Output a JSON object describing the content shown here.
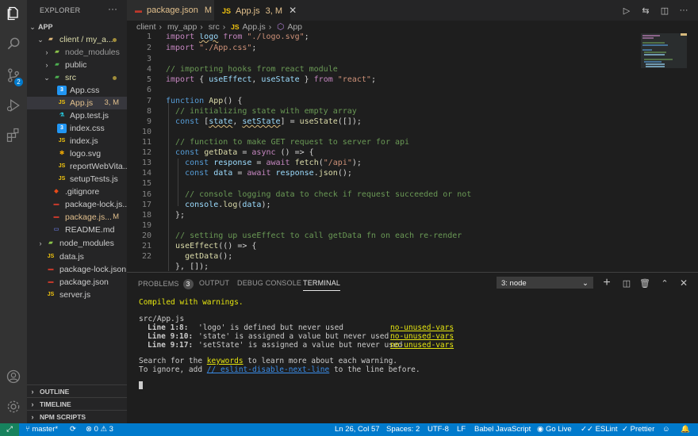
{
  "activity": {
    "scm_badge": "2"
  },
  "sidebar": {
    "title": "EXPLORER",
    "more": "···",
    "tree": [
      {
        "label": "APP",
        "badge": ""
      },
      {
        "label": "client / my_a...",
        "badge": ""
      },
      {
        "label": "node_modules",
        "badge": ""
      },
      {
        "label": "public",
        "badge": ""
      },
      {
        "label": "src",
        "badge": ""
      },
      {
        "label": "App.css",
        "badge": ""
      },
      {
        "label": "App.js",
        "badge": "3, M"
      },
      {
        "label": "App.test.js",
        "badge": ""
      },
      {
        "label": "index.css",
        "badge": ""
      },
      {
        "label": "index.js",
        "badge": ""
      },
      {
        "label": "logo.svg",
        "badge": ""
      },
      {
        "label": "reportWebVita...",
        "badge": ""
      },
      {
        "label": "setupTests.js",
        "badge": ""
      },
      {
        "label": ".gitignore",
        "badge": ""
      },
      {
        "label": "package-lock.js...",
        "badge": ""
      },
      {
        "label": "package.js...",
        "badge": "M"
      },
      {
        "label": "README.md",
        "badge": ""
      },
      {
        "label": "node_modules",
        "badge": ""
      },
      {
        "label": "data.js",
        "badge": ""
      },
      {
        "label": "package-lock.json",
        "badge": ""
      },
      {
        "label": "package.json",
        "badge": ""
      },
      {
        "label": "server.js",
        "badge": ""
      }
    ],
    "sections": [
      "OUTLINE",
      "TIMELINE",
      "NPM SCRIPTS"
    ]
  },
  "tabs": [
    {
      "label": "package.json",
      "badge": "M"
    },
    {
      "label": "App.js",
      "badge": "3, M"
    }
  ],
  "breadcrumbs": [
    "client",
    "my_app",
    "src",
    "App.js",
    "App"
  ],
  "editor": {
    "line_numbers": [
      "1",
      "2",
      "3",
      "4",
      "5",
      "6",
      "7",
      "8",
      "9",
      "10",
      "11",
      "12",
      "13",
      "14",
      "15",
      "16",
      "17",
      "18",
      "19",
      "20",
      "21",
      "22"
    ],
    "lines": [
      "import logo from \"./logo.svg\";",
      "import \"./App.css\";",
      "",
      "// importing hooks from react module",
      "import { useEffect, useState } from \"react\";",
      "",
      "function App() {",
      "  // initializing state with empty array",
      "  const [state, setState] = useState([]);",
      "",
      "  // function to make GET request to server for api",
      "  const getData = async () => {",
      "    const response = await fetch(\"/api\");",
      "    const data = await response.json();",
      "",
      "    // console logging data to check if request succeeded or not",
      "    console.log(data);",
      "  };",
      "",
      "  // setting up useEffect to call getData fn on each re-render",
      "  useEffect(() => {",
      "    getData();",
      "  }, []);"
    ]
  },
  "panel": {
    "tabs": [
      "PROBLEMS",
      "OUTPUT",
      "DEBUG CONSOLE",
      "TERMINAL"
    ],
    "problems_count": "3",
    "terminal_select": "3: node",
    "terminal": {
      "compiled": "Compiled with warnings.",
      "file": "src/App.js",
      "warnings": [
        {
          "loc": "Line 1:8:",
          "msg": "'logo' is defined but never used",
          "rule": "no-unused-vars"
        },
        {
          "loc": "Line 9:10:",
          "msg": "'state' is assigned a value but never used",
          "rule": "no-unused-vars"
        },
        {
          "loc": "Line 9:17:",
          "msg": "'setState' is assigned a value but never used",
          "rule": "no-unused-vars"
        }
      ],
      "search_pre": "Search for the ",
      "search_link": "keywords",
      "search_post": " to learn more about each warning.",
      "ignore_pre": "To ignore, add ",
      "ignore_link": "// eslint-disable-next-line",
      "ignore_post": " to the line before."
    }
  },
  "status": {
    "branch": "master*",
    "problems": "⊗ 0 ⚠ 3",
    "position": "Ln 26, Col 57",
    "spaces": "Spaces: 2",
    "encoding": "UTF-8",
    "eol": "LF",
    "language": "Babel JavaScript",
    "golive": "Go Live",
    "eslint": "ESLint",
    "prettier": "Prettier"
  },
  "colors": {
    "accent": "#007acc",
    "remote": "#16825d",
    "warning": "#e5e510"
  }
}
